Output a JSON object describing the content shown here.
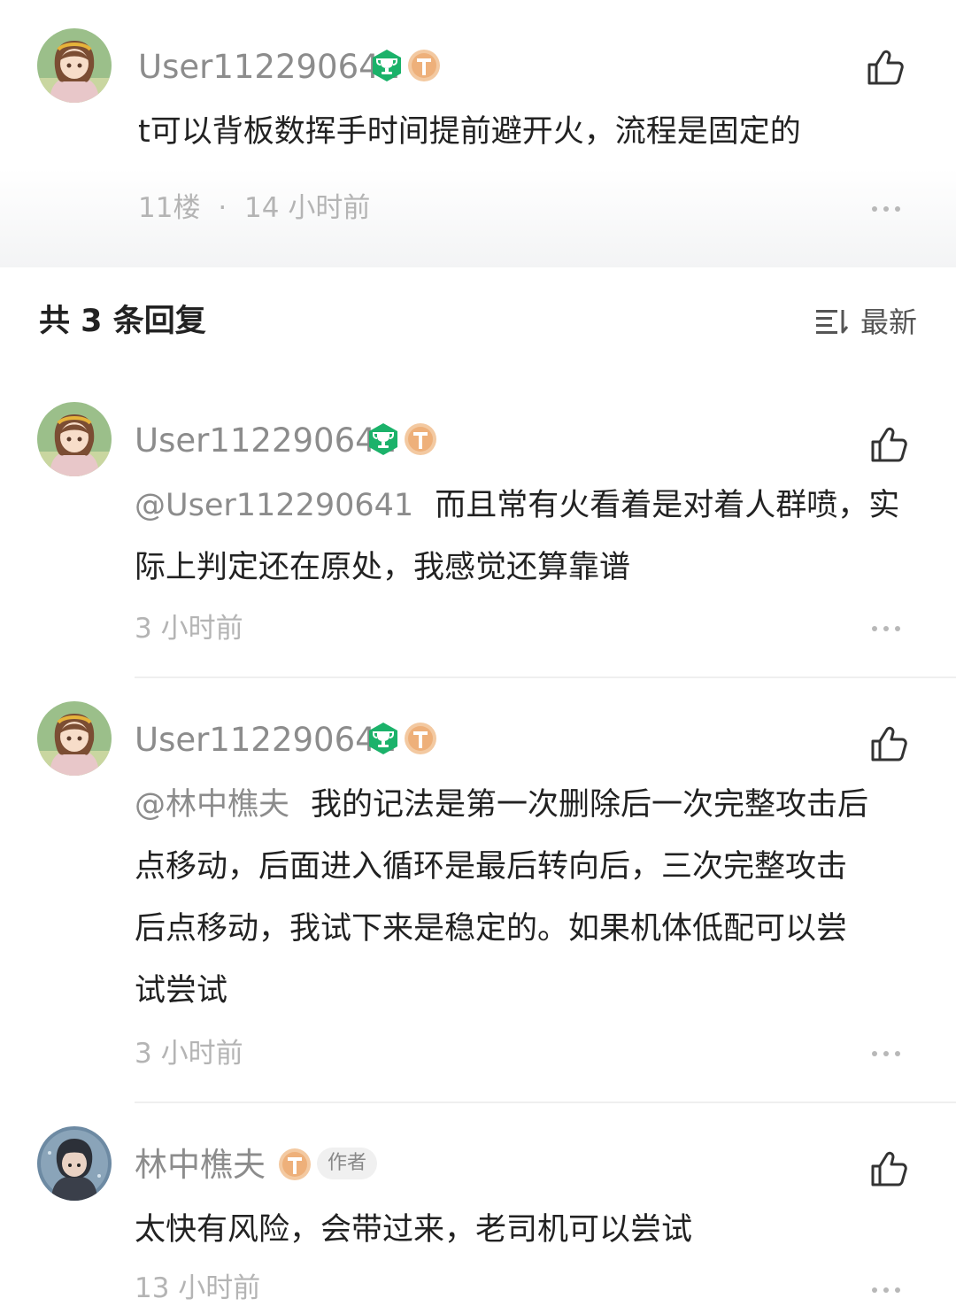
{
  "main_comment": {
    "username": "User112290641",
    "text": "t可以背板数挥手时间提前避开火，流程是固定的",
    "floor": "11楼",
    "sep": "·",
    "time": "14 小时前",
    "level_badge": "T4"
  },
  "replies_header": {
    "title": "共 3 条回复",
    "sort_label": "最新"
  },
  "replies": [
    {
      "username": "User112290641",
      "level_badge": "T4",
      "mention": "@User112290641",
      "line1": "而且常有火看着是对着人群喷，实",
      "line2": "际上判定还在原处，我感觉还算靠谱",
      "time": "3 小时前"
    },
    {
      "username": "User112290641",
      "level_badge": "T4",
      "mention": "@林中樵夫",
      "line1": "我的记法是第一次删除后一次完整攻击后",
      "line2": "点移动，后面进入循环是最后转向后，三次完整攻击",
      "line3": "后点移动，我试下来是稳定的。如果机体低配可以尝",
      "line4": "试尝试",
      "time": "3 小时前"
    },
    {
      "username": "林中樵夫",
      "level_badge": "T5",
      "author_tag": "作者",
      "line1": "太快有风险，会带过来，老司机可以尝试",
      "time": "13 小时前"
    }
  ],
  "icons": {
    "trophy": "trophy-badge-icon",
    "level": "level-badge-icon",
    "like": "thumbs-up-icon",
    "more": "more-dots-icon",
    "sort": "sort-icon"
  },
  "colors": {
    "trophy_green": "#1bb26a",
    "level_orange": "#f0b583",
    "text_primary": "#222222",
    "text_secondary": "#8c8c8c",
    "text_meta": "#b4b4b4"
  }
}
